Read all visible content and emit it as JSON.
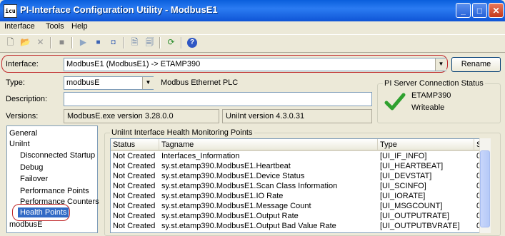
{
  "window": {
    "title": "PI-Interface Configuration Utility - ModbusE1",
    "icon_text": "icu"
  },
  "menu": [
    "Interface",
    "Tools",
    "Help"
  ],
  "interface": {
    "label": "Interface:",
    "value": "ModbusE1 (ModbusE1) -> ETAMP390",
    "rename": "Rename"
  },
  "type": {
    "label": "Type:",
    "value": "modbusE",
    "desc": "Modbus Ethernet PLC"
  },
  "description": {
    "label": "Description:",
    "value": ""
  },
  "versions": {
    "label": "Versions:",
    "exe": "ModbusE.exe version 3.28.0.0",
    "uniint": "UniInt version 4.3.0.31"
  },
  "server_status": {
    "title": "PI Server Connection Status",
    "server": "ETAMP390",
    "state": "Writeable"
  },
  "tree": [
    "General",
    "UniInt",
    "Disconnected Startup",
    "Debug",
    "Failover",
    "Performance Points",
    "Performance Counters",
    "Health Points",
    "modbusE"
  ],
  "health": {
    "title": "UniInt Interface Health Monitoring Points",
    "columns": [
      "Status",
      "Tagname",
      "Type",
      "S"
    ],
    "rows": [
      [
        "Not Created",
        "Interfaces_Information",
        "[UI_IF_INFO]",
        "0"
      ],
      [
        "Not Created",
        "sy.st.etamp390.ModbusE1.Heartbeat",
        "[UI_HEARTBEAT]",
        "0"
      ],
      [
        "Not Created",
        "sy.st.etamp390.ModbusE1.Device Status",
        "[UI_DEVSTAT]",
        "0"
      ],
      [
        "Not Created",
        "sy.st.etamp390.ModbusE1.Scan Class Information",
        "[UI_SCINFO]",
        "0"
      ],
      [
        "Not Created",
        "sy.st.etamp390.ModbusE1.IO Rate",
        "[UI_IORATE]",
        "0"
      ],
      [
        "Not Created",
        "sy.st.etamp390.ModbusE1.Message Count",
        "[UI_MSGCOUNT]",
        "0"
      ],
      [
        "Not Created",
        "sy.st.etamp390.ModbusE1.Output Rate",
        "[UI_OUTPUTRATE]",
        "0"
      ],
      [
        "Not Created",
        "sy.st.etamp390.ModbusE1.Output Bad Value Rate",
        "[UI_OUTPUTBVRATE]",
        "0"
      ]
    ]
  },
  "colors": {
    "title_bar": "#0a5fdc",
    "highlight": "#c0282a",
    "check": "#2fa12f"
  }
}
